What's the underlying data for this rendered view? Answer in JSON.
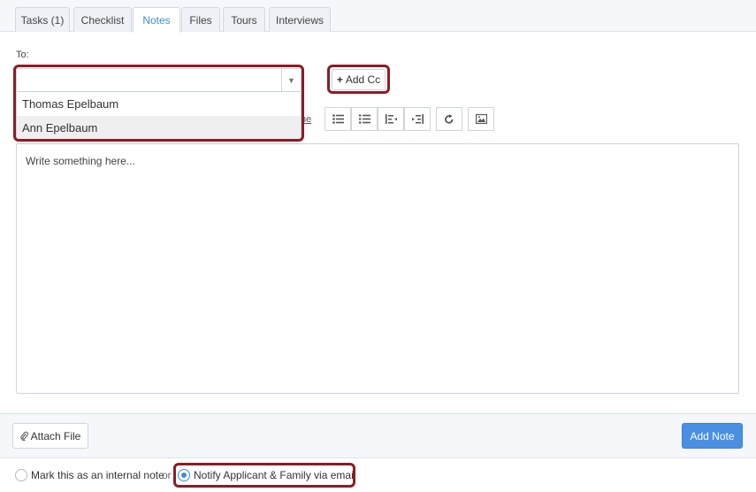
{
  "tabs": [
    {
      "label": "Tasks (1)",
      "active": false
    },
    {
      "label": "Checklist",
      "active": false
    },
    {
      "label": "Notes",
      "active": true
    },
    {
      "label": "Files",
      "active": false
    },
    {
      "label": "Tours",
      "active": false
    },
    {
      "label": "Interviews",
      "active": false
    }
  ],
  "to": {
    "label": "To:",
    "value": "",
    "options": [
      "Thomas Epelbaum",
      "Ann Epelbaum"
    ],
    "hovered_option": "Ann Epelbaum"
  },
  "add_cc": {
    "label": "Add Cc"
  },
  "toolbar": {
    "partial_label": "ne",
    "buttons": [
      "bulleted-list-icon",
      "numbered-list-icon",
      "outdent-icon",
      "indent-icon",
      "redo-icon",
      "image-icon"
    ]
  },
  "editor": {
    "placeholder": "Write something here..."
  },
  "footer": {
    "attach_label": "Attach File",
    "add_note_label": "Add Note"
  },
  "visibility": {
    "internal_label": "Mark this as an internal note",
    "or_label": "or",
    "notify_label": "Notify Applicant & Family via email",
    "selected": "notify"
  },
  "colors": {
    "accent": "#4a90e2",
    "highlight": "#8c1c24",
    "active_tab_text": "#3d8fd6"
  }
}
